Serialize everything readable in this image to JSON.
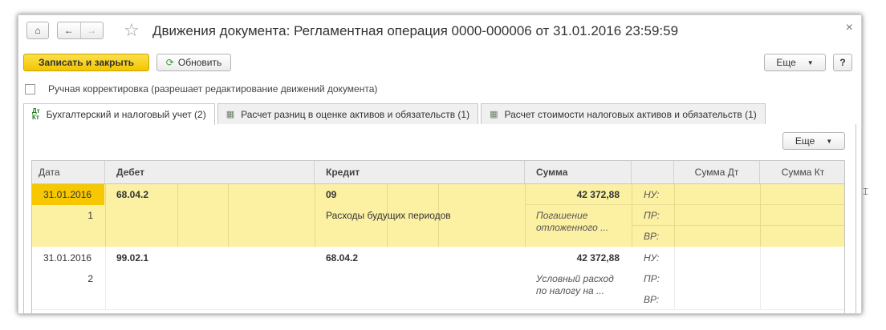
{
  "window": {
    "title": "Движения документа: Регламентная операция 0000-000006 от 31.01.2016 23:59:59",
    "close_label": "×"
  },
  "toolbar": {
    "home_glyph": "⌂",
    "back_glyph": "←",
    "forward_glyph": "→",
    "star_glyph": "☆",
    "save_close_label": "Записать и закрыть",
    "refresh_label": "Обновить",
    "more_label": "Еще",
    "help_label": "?"
  },
  "manual_edit": {
    "label": "Ручная корректировка (разрешает редактирование движений документа)",
    "checked": false
  },
  "tabs": [
    {
      "label": "Бухгалтерский и налоговый учет (2)",
      "active": true,
      "icon": "dt-kt-icon",
      "icon_top": "Дт",
      "icon_bottom": "Кт"
    },
    {
      "label": "Расчет разниц в оценке активов и обязательств (1)",
      "active": false,
      "icon": "table-icon"
    },
    {
      "label": "Расчет стоимости налоговых активов и обязательств (1)",
      "active": false,
      "icon": "table-icon"
    }
  ],
  "table_more_label": "Еще",
  "table": {
    "headers": {
      "date": "Дата",
      "debit": "Дебет",
      "credit": "Кредит",
      "sum": "Сумма",
      "sum_dt": "Сумма Дт",
      "sum_kt": "Сумма Кт"
    },
    "rows": [
      {
        "date": "31.01.2016",
        "num": "1",
        "debit": "68.04.2",
        "credit": "09",
        "credit_sub": "Расходы будущих периодов",
        "sum": "42 372,88",
        "content_line1": "Погашение",
        "content_line2": "отложенного ...",
        "nu": "НУ:",
        "pr": "ПР:",
        "vr": "ВР:",
        "selected": true
      },
      {
        "date": "31.01.2016",
        "num": "2",
        "debit": "99.02.1",
        "credit": "68.04.2",
        "credit_sub": "",
        "sum": "42 372,88",
        "content_line1": "Условный расход",
        "content_line2": "по налогу на ...",
        "nu": "НУ:",
        "pr": "ПР:",
        "vr": "ВР:",
        "selected": false
      }
    ]
  },
  "colors": {
    "primary_button": "#f3c600",
    "selected_row": "#fcf0a3",
    "selected_cell": "#f7c700",
    "header_bg": "#eeeeee"
  }
}
